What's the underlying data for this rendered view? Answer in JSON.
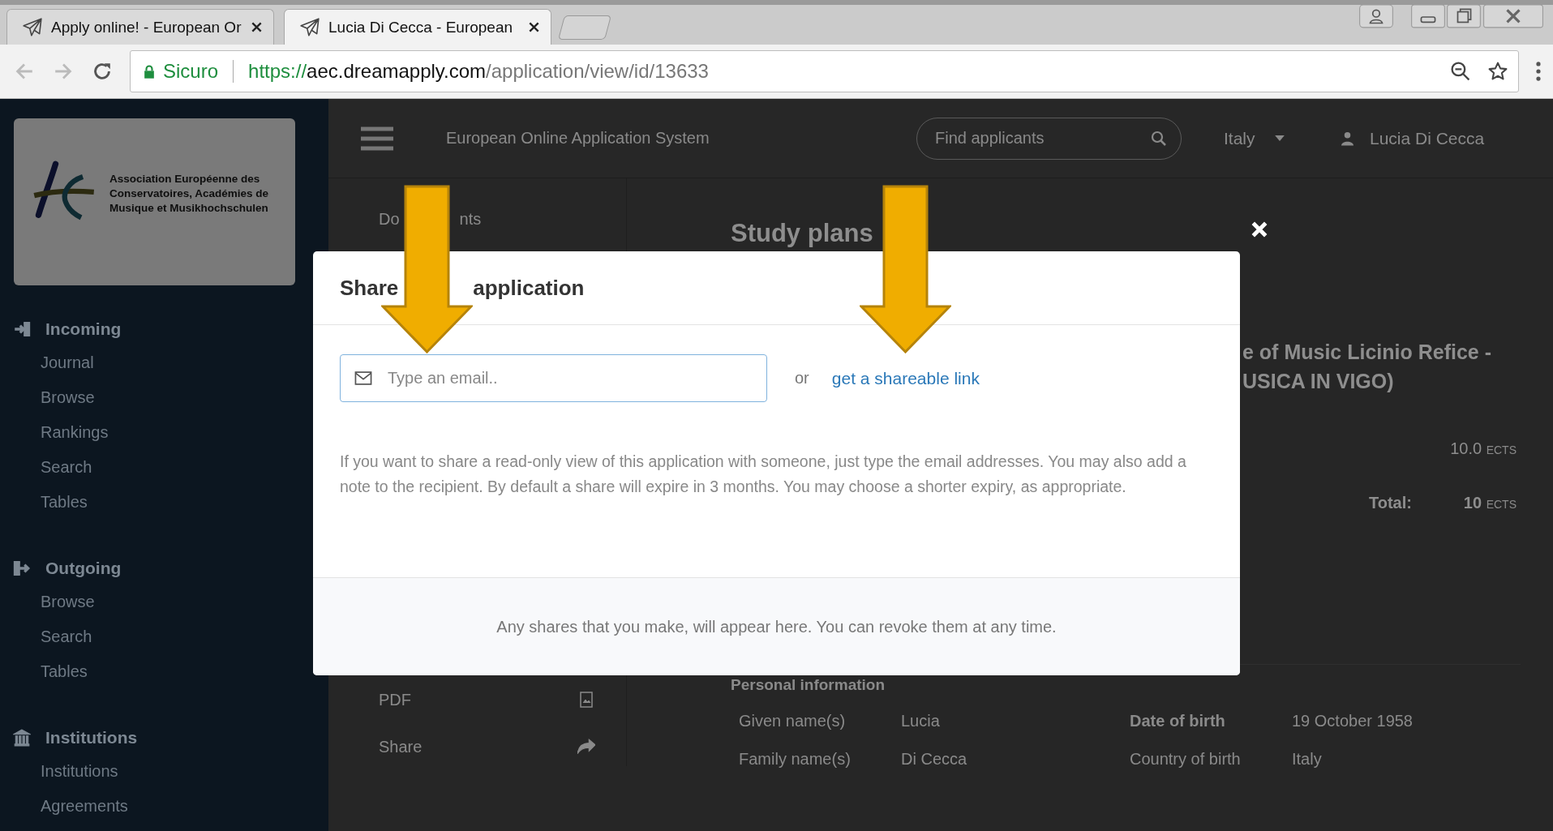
{
  "browser": {
    "tabs": [
      {
        "title": "Apply online! - European Or",
        "selected": false
      },
      {
        "title": "Lucia Di Cecca - European",
        "selected": true
      }
    ],
    "security_label": "Sicuro",
    "url": {
      "scheme": "https://",
      "host": "aec.dreamapply.com",
      "path": "/application/view/id/13633"
    }
  },
  "sidebar": {
    "logo_text": "Association Européenne des Conservatoires, Académies de Musique et Musikhochschulen",
    "sections": [
      {
        "title": "Incoming",
        "kind": "incoming",
        "items": [
          "Journal",
          "Browse",
          "Rankings",
          "Search",
          "Tables"
        ]
      },
      {
        "title": "Outgoing",
        "kind": "outgoing",
        "items": [
          "Browse",
          "Search",
          "Tables"
        ]
      },
      {
        "title": "Institutions",
        "kind": "institutions",
        "items": [
          "Institutions",
          "Agreements"
        ]
      }
    ]
  },
  "header": {
    "app_title": "European Online Application System",
    "search": {
      "placeholder": "Find applicants"
    },
    "country": "Italy",
    "user": "Lucia Di Cecca"
  },
  "subnav": [
    {
      "kind": "plain",
      "label_parts": [
        "Do",
        "nts"
      ]
    },
    {
      "kind": "pdf",
      "label_parts": [
        "PDF"
      ]
    },
    {
      "kind": "share",
      "label_parts": [
        "Share"
      ]
    }
  ],
  "content": {
    "heading": "Study plans",
    "program_fragments": [
      "e of Music Licinio Refice -",
      "USICA IN VIGO)"
    ],
    "credits": {
      "value": "10.0",
      "unit": "ECTS"
    },
    "total": {
      "label": "Total:",
      "value": "10",
      "unit": "ECTS"
    },
    "personal": {
      "title": "Personal information",
      "fields": [
        {
          "label": "Given name(s)",
          "value": "Lucia",
          "bold": false
        },
        {
          "label": "Date of birth",
          "value": "19 October 1958",
          "bold": true
        },
        {
          "label": "Family name(s)",
          "value": "Di Cecca",
          "bold": false
        },
        {
          "label": "Country of birth",
          "value": "Italy",
          "bold": false
        }
      ]
    }
  },
  "modal": {
    "title_parts": [
      "Share",
      "application"
    ],
    "email": {
      "placeholder": "Type an email.."
    },
    "or": "or",
    "link": "get a shareable link",
    "description": "If you want to share a read-only view of this application with someone, just type the email addresses. You may also add a note to the recipient. By default a share will expire in 3 months. You may choose a shorter expiry, as appropriate.",
    "footer": "Any shares that you make, will appear here. You can revoke them at any time."
  }
}
